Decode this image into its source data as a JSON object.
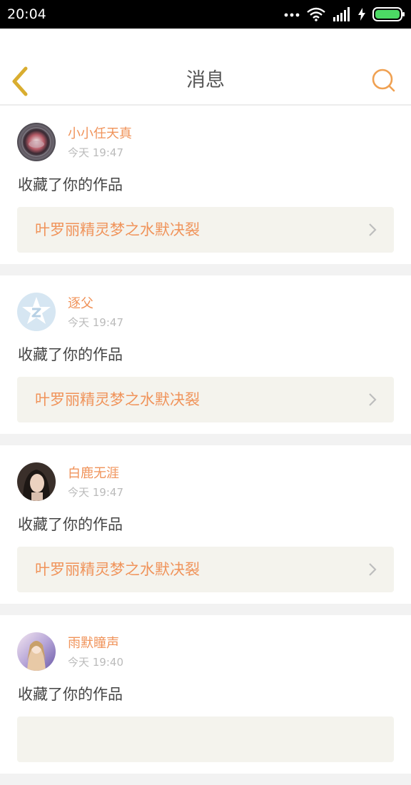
{
  "status_bar": {
    "time": "20:04",
    "icons": [
      "more-dots-icon",
      "wifi-icon",
      "signal-icon",
      "charging-icon",
      "battery-icon"
    ],
    "battery_color": "#4cd964"
  },
  "nav": {
    "title": "消息",
    "back_icon": "chevron-left-icon",
    "search_icon": "search-icon",
    "accent_color": "#f0a152"
  },
  "messages": [
    {
      "username": "小小任天真",
      "time": "今天 19:47",
      "action": "收藏了你的作品",
      "work_title": "叶罗丽精灵梦之水默决裂"
    },
    {
      "username": "逐父",
      "time": "今天 19:47",
      "action": "收藏了你的作品",
      "work_title": "叶罗丽精灵梦之水默决裂"
    },
    {
      "username": "白鹿无涯",
      "time": "今天 19:47",
      "action": "收藏了你的作品",
      "work_title": "叶罗丽精灵梦之水默决裂"
    },
    {
      "username": "雨默瞳声",
      "time": "今天 19:40",
      "action": "收藏了你的作品",
      "work_title": ""
    }
  ],
  "colors": {
    "username": "#f0935a",
    "work_title": "#f0935a",
    "work_background": "#f4f3ed",
    "divider": "#f2f2f2"
  }
}
